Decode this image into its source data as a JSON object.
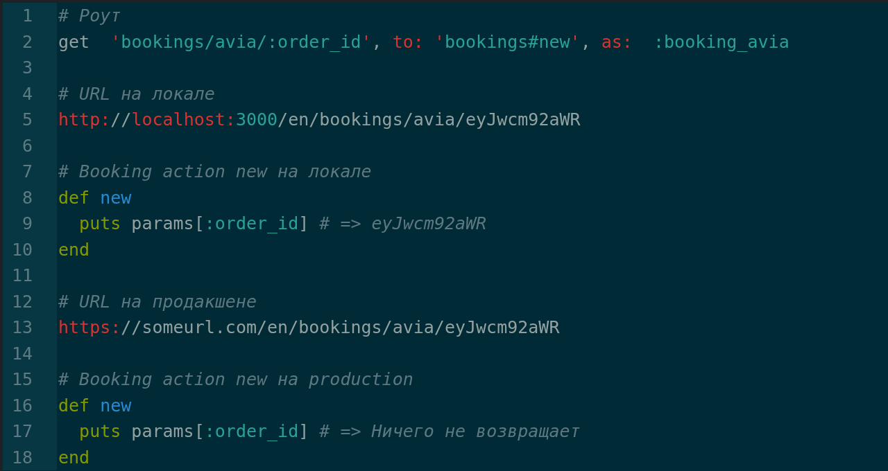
{
  "editor": {
    "lines": [
      {
        "number": "1",
        "tokens": [
          {
            "kind": "comment",
            "text": "# Роут"
          }
        ]
      },
      {
        "number": "2",
        "tokens": [
          {
            "kind": "plain",
            "text": "get  "
          },
          {
            "kind": "symbol",
            "text": "'"
          },
          {
            "kind": "string",
            "text": "bookings/avia/:order_id"
          },
          {
            "kind": "symbol",
            "text": "'"
          },
          {
            "kind": "plain",
            "text": ", "
          },
          {
            "kind": "symbol",
            "text": "to: '"
          },
          {
            "kind": "string",
            "text": "bookings#new"
          },
          {
            "kind": "symbol",
            "text": "'"
          },
          {
            "kind": "plain",
            "text": ", "
          },
          {
            "kind": "symbol",
            "text": "as:  "
          },
          {
            "kind": "string",
            "text": ":booking_avia"
          }
        ]
      },
      {
        "number": "3"
      },
      {
        "number": "4",
        "tokens": [
          {
            "kind": "comment",
            "text": "# URL на локале"
          }
        ]
      },
      {
        "number": "5",
        "tokens": [
          {
            "kind": "symbol",
            "text": "http:"
          },
          {
            "kind": "plain",
            "text": "//"
          },
          {
            "kind": "symbol",
            "text": "localhost:"
          },
          {
            "kind": "string",
            "text": "3000"
          },
          {
            "kind": "plain",
            "text": "/en/bookings/avia/eyJwcm92aWR"
          }
        ]
      },
      {
        "number": "6"
      },
      {
        "number": "7",
        "tokens": [
          {
            "kind": "comment",
            "text": "# Booking action new на локале"
          }
        ]
      },
      {
        "number": "8",
        "tokens": [
          {
            "kind": "keyword",
            "text": "def "
          },
          {
            "kind": "name",
            "text": "new"
          }
        ]
      },
      {
        "number": "9",
        "tokens": [
          {
            "kind": "keyword",
            "text": "  puts"
          },
          {
            "kind": "plain",
            "text": " params["
          },
          {
            "kind": "string",
            "text": ":order_id"
          },
          {
            "kind": "plain",
            "text": "] "
          },
          {
            "kind": "comment",
            "text": "# => eyJwcm92aWR"
          }
        ]
      },
      {
        "number": "10",
        "tokens": [
          {
            "kind": "keyword",
            "text": "end"
          }
        ]
      },
      {
        "number": "11"
      },
      {
        "number": "12",
        "tokens": [
          {
            "kind": "comment",
            "text": "# URL на продакшене"
          }
        ]
      },
      {
        "number": "13",
        "tokens": [
          {
            "kind": "symbol",
            "text": "https:"
          },
          {
            "kind": "plain",
            "text": "//someurl.com/en/bookings/avia/eyJwcm92aWR"
          }
        ]
      },
      {
        "number": "14"
      },
      {
        "number": "15",
        "tokens": [
          {
            "kind": "comment",
            "text": "# Booking action new на production"
          }
        ]
      },
      {
        "number": "16",
        "tokens": [
          {
            "kind": "keyword",
            "text": "def "
          },
          {
            "kind": "name",
            "text": "new"
          }
        ]
      },
      {
        "number": "17",
        "tokens": [
          {
            "kind": "keyword",
            "text": "  puts"
          },
          {
            "kind": "plain",
            "text": " params["
          },
          {
            "kind": "string",
            "text": ":order_id"
          },
          {
            "kind": "plain",
            "text": "] "
          },
          {
            "kind": "comment",
            "text": "# => Ничего не возвращает"
          }
        ]
      },
      {
        "number": "18",
        "tokens": [
          {
            "kind": "keyword",
            "text": "end"
          }
        ]
      }
    ]
  }
}
